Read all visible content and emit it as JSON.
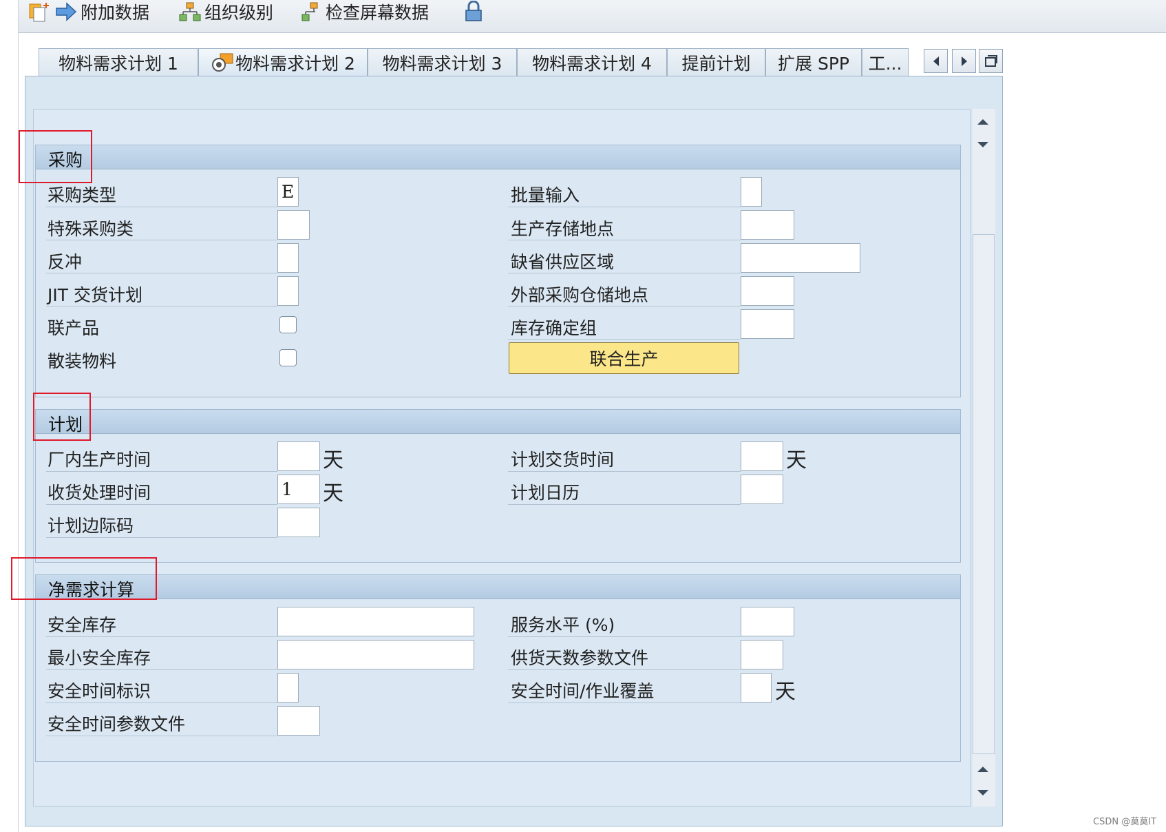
{
  "toolbar": {
    "additional_data": "附加数据",
    "org_levels": "组织级别",
    "check_screen_data": "检查屏幕数据"
  },
  "tabs": [
    {
      "label": "物料需求计划 1"
    },
    {
      "label": "物料需求计划 2"
    },
    {
      "label": "物料需求计划 3"
    },
    {
      "label": "物料需求计划 4"
    },
    {
      "label": "提前计划"
    },
    {
      "label": "扩展 SPP"
    },
    {
      "label": "工..."
    }
  ],
  "procurement": {
    "title": "采购",
    "procurement_type": {
      "label": "采购类型",
      "value": "E"
    },
    "special_procurement": {
      "label": "特殊采购类",
      "value": ""
    },
    "backflush": {
      "label": "反冲",
      "value": ""
    },
    "jit_schedule": {
      "label": "JIT 交货计划",
      "value": ""
    },
    "co_product": {
      "label": "联产品"
    },
    "bulk_material": {
      "label": "散装物料"
    },
    "batch_entry": {
      "label": "批量输入",
      "value": ""
    },
    "prod_storage_loc": {
      "label": "生产存储地点",
      "value": ""
    },
    "default_supply_area": {
      "label": "缺省供应区域",
      "value": ""
    },
    "ext_proc_storage_loc": {
      "label": "外部采购仓储地点",
      "value": ""
    },
    "stock_det_group": {
      "label": "库存确定组",
      "value": ""
    },
    "joint_production_button": "联合生产"
  },
  "planning": {
    "title": "计划",
    "in_house_prod_time": {
      "label": "厂内生产时间",
      "value": "",
      "unit": "天"
    },
    "gr_processing_time": {
      "label": "收货处理时间",
      "value": "1",
      "unit": "天"
    },
    "sched_margin_key": {
      "label": "计划边际码",
      "value": ""
    },
    "planned_delivery_time": {
      "label": "计划交货时间",
      "value": "",
      "unit": "天"
    },
    "planning_calendar": {
      "label": "计划日历",
      "value": ""
    }
  },
  "net_requirements": {
    "title": "净需求计算",
    "safety_stock": {
      "label": "安全库存",
      "value": ""
    },
    "min_safety_stock": {
      "label": "最小安全库存",
      "value": ""
    },
    "safety_time_ind": {
      "label": "安全时间标识",
      "value": ""
    },
    "safety_time_profile": {
      "label": "安全时间参数文件",
      "value": ""
    },
    "service_level": {
      "label": "服务水平 (%)",
      "value": ""
    },
    "coverage_profile": {
      "label": "供货天数参数文件",
      "value": ""
    },
    "safety_time_coverage": {
      "label": "安全时间/作业覆盖",
      "value": "",
      "unit": "天"
    }
  },
  "watermark": "CSDN @莫莫IT",
  "colors": {
    "highlight_box": "#e0192a",
    "button_yellow": "#fbe68a"
  }
}
